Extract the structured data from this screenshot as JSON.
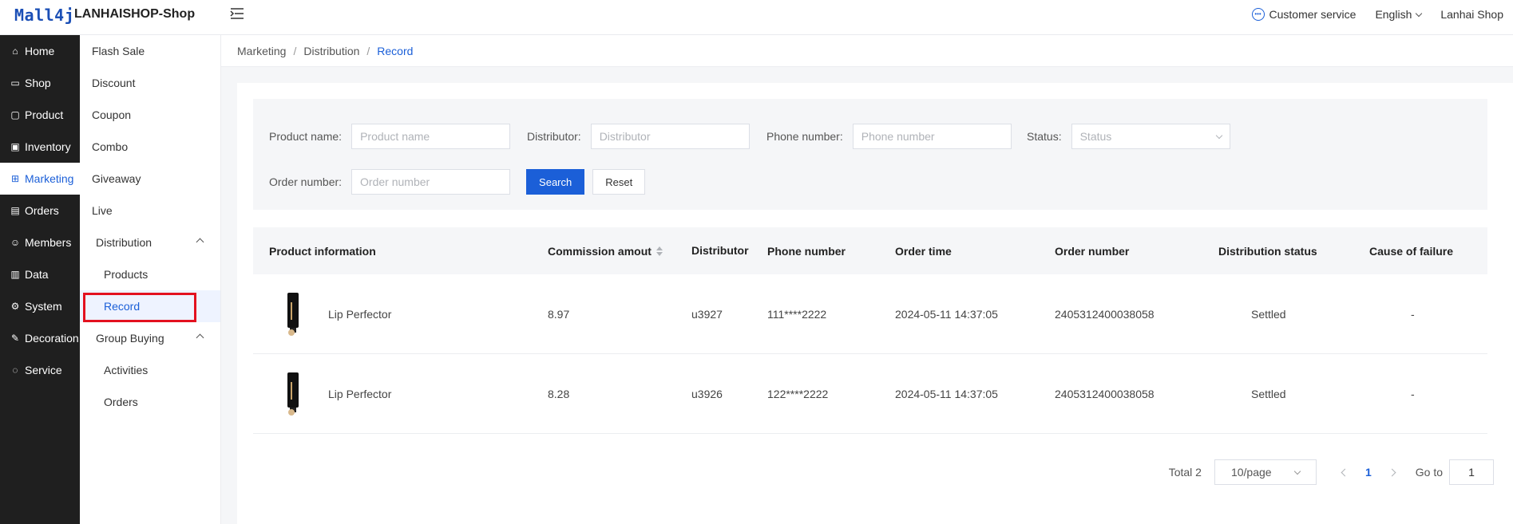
{
  "header": {
    "logo": "Mall4j",
    "shop_title": "LANHAISHOP-Shop",
    "customer_service": "Customer service",
    "language": "English",
    "user": "Lanhai Shop"
  },
  "primary_nav": [
    {
      "label": "Home",
      "icon": "home-icon"
    },
    {
      "label": "Shop",
      "icon": "shop-icon"
    },
    {
      "label": "Product",
      "icon": "product-icon"
    },
    {
      "label": "Inventory",
      "icon": "inventory-icon"
    },
    {
      "label": "Marketing",
      "icon": "gift-icon"
    },
    {
      "label": "Orders",
      "icon": "orders-icon"
    },
    {
      "label": "Members",
      "icon": "members-icon"
    },
    {
      "label": "Data",
      "icon": "data-icon"
    },
    {
      "label": "System",
      "icon": "gear-icon"
    },
    {
      "label": "Decoration",
      "icon": "decoration-icon"
    },
    {
      "label": "Service",
      "icon": "chat-icon"
    }
  ],
  "secondary_nav": {
    "items": [
      "Flash Sale",
      "Discount",
      "Coupon",
      "Combo",
      "Giveaway",
      "Live"
    ],
    "distribution": {
      "label": "Distribution",
      "children": [
        "Products",
        "Record"
      ]
    },
    "group_buying": {
      "label": "Group Buying",
      "children": [
        "Activities",
        "Orders"
      ]
    }
  },
  "breadcrumb": [
    "Marketing",
    "Distribution",
    "Record"
  ],
  "filters": {
    "product_name": {
      "label": "Product name:",
      "placeholder": "Product name"
    },
    "distributor": {
      "label": "Distributor:",
      "placeholder": "Distributor"
    },
    "phone": {
      "label": "Phone number:",
      "placeholder": "Phone number"
    },
    "status": {
      "label": "Status:",
      "placeholder": "Status"
    },
    "order_number": {
      "label": "Order number:",
      "placeholder": "Order number"
    },
    "search_label": "Search",
    "reset_label": "Reset"
  },
  "table": {
    "headers": [
      "Product information",
      "Commission amout",
      "Distributor",
      "Phone number",
      "Order time",
      "Order number",
      "Distribution status",
      "Cause of failure"
    ],
    "rows": [
      {
        "product": "Lip Perfector",
        "commission": "8.97",
        "distributor": "u3927",
        "phone": "111****2222",
        "time": "2024-05-11 14:37:05",
        "order": "2405312400038058",
        "status": "Settled",
        "cause": "-"
      },
      {
        "product": "Lip Perfector",
        "commission": "8.28",
        "distributor": "u3926",
        "phone": "122****2222",
        "time": "2024-05-11 14:37:05",
        "order": "2405312400038058",
        "status": "Settled",
        "cause": "-"
      }
    ]
  },
  "pagination": {
    "total": "Total 2",
    "page_size": "10/page",
    "current_page": "1",
    "goto_label": "Go to",
    "goto_value": "1"
  },
  "colors": {
    "accent": "#1b5fd8",
    "highlight": "#e3111f",
    "sidebar_bg": "#1f1f1f"
  }
}
